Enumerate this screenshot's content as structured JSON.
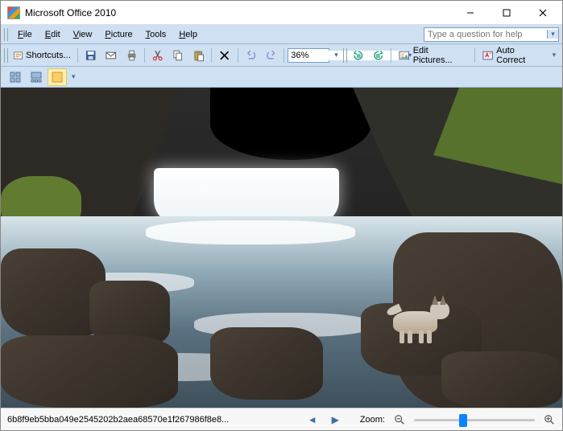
{
  "title": "Microsoft Office 2010",
  "menu": {
    "file": "File",
    "edit": "Edit",
    "view": "View",
    "picture": "Picture",
    "tools": "Tools",
    "help": "Help"
  },
  "helpbox_placeholder": "Type a question for help",
  "toolbar": {
    "shortcuts": "Shortcuts...",
    "zoom_value": "36%",
    "edit_pictures": "Edit Pictures...",
    "auto_correct": "Auto Correct"
  },
  "status": {
    "filename": "6b8f9eb5bba049e2545202b2aea68570e1f267986f8e8...",
    "zoom_label": "Zoom:",
    "slider_percent": 40
  }
}
